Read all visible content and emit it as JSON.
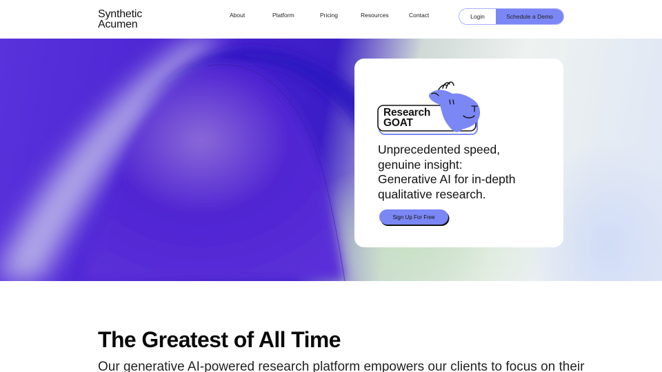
{
  "header": {
    "logo": {
      "line1": "Synthetic",
      "line2": "Acumen",
      "accent_color": "#7b87f5"
    },
    "nav": [
      {
        "label": "About"
      },
      {
        "label": "Platform"
      },
      {
        "label": "Pricing"
      },
      {
        "label": "Resources"
      },
      {
        "label": "Contact"
      }
    ],
    "login_label": "Login",
    "demo_label": "Schedule a Demo"
  },
  "hero": {
    "badge": {
      "line1": "Research",
      "line2": "GOAT",
      "mascot_icon": "goat-icon",
      "mascot_color": "#7b87f5"
    },
    "tagline": [
      "Unprecedented speed,",
      "genuine insight:",
      "Generative AI for in-depth",
      "qualitative research."
    ],
    "cta_label": "Sign Up For Free",
    "cta_color": "#7b87f5"
  },
  "section": {
    "title": "The Greatest of All Time",
    "body": "Our generative AI-powered research platform empowers our clients to focus on their"
  }
}
